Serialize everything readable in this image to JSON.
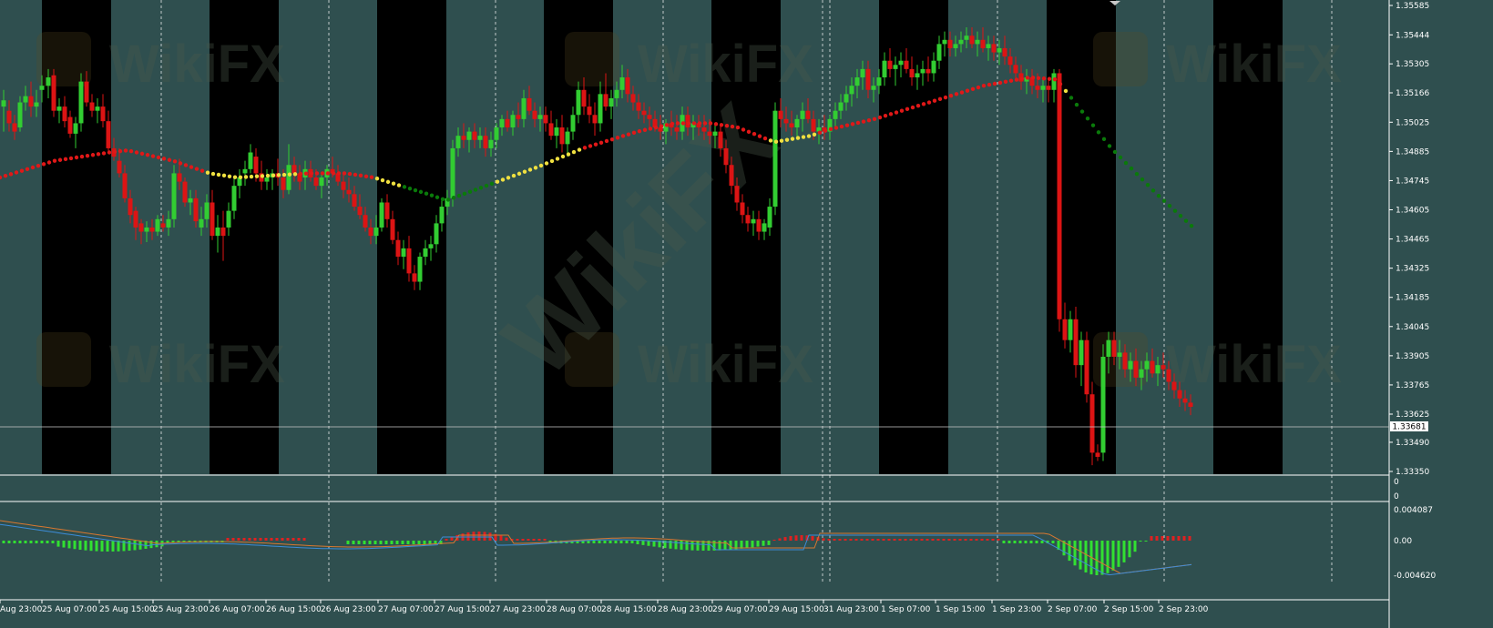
{
  "colors": {
    "background": "#2f4f4f",
    "session_dark": "#000000",
    "bull_candle": "#32cd32",
    "bear_candle": "#dc1414",
    "ma_up": "#e01818",
    "ma_flat": "#f0e040",
    "ma_down": "#0a7a0a",
    "macd_pos": "#e02020",
    "macd_neg": "#32e032",
    "signal_line_1": "#d87830",
    "signal_line_2": "#3c8cd8",
    "grid": "#ffffff",
    "text": "#ffffff"
  },
  "watermark": "WikiFX",
  "price_axis": {
    "ticks": [
      "1.35585",
      "1.35444",
      "1.35305",
      "1.35166",
      "1.35025",
      "1.34885",
      "1.34745",
      "1.34605",
      "1.34465",
      "1.34325",
      "1.34185",
      "1.34045",
      "1.33905",
      "1.33765",
      "1.33625",
      "1.33490",
      "1.33350"
    ],
    "current_price": "1.33681"
  },
  "middle_axis": {
    "ticks": [
      "0",
      "0"
    ]
  },
  "macd_axis": {
    "ticks": [
      "0.004087",
      "0.00",
      "-0.004620"
    ]
  },
  "time_axis": {
    "labels": [
      "Aug 23:00",
      "25 Aug 07:00",
      "25 Aug 15:00",
      "25 Aug 23:00",
      "26 Aug 07:00",
      "26 Aug 15:00",
      "26 Aug 23:00",
      "27 Aug 07:00",
      "27 Aug 15:00",
      "27 Aug 23:00",
      "28 Aug 07:00",
      "28 Aug 15:00",
      "28 Aug 23:00",
      "29 Aug 07:00",
      "29 Aug 15:00",
      "31 Aug 23:00",
      "1 Sep 07:00",
      "1 Sep 15:00",
      "1 Sep 23:00",
      "2 Sep 07:00",
      "2 Sep 15:00",
      "2 Sep 23:00"
    ]
  }
}
